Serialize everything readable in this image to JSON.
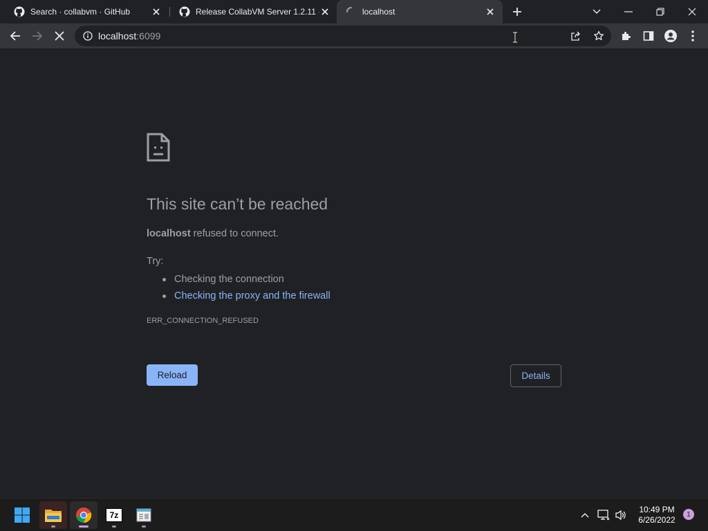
{
  "browser": {
    "tabs": [
      {
        "title": "Search · collabvm · GitHub",
        "icon": "github-icon",
        "active": false
      },
      {
        "title": "Release CollabVM Server 1.2.11 ·",
        "icon": "github-icon",
        "active": false
      },
      {
        "title": "localhost",
        "icon": "loading-spinner-icon",
        "active": true
      }
    ],
    "address": {
      "host": "localhost",
      "port": ":6099"
    }
  },
  "error_page": {
    "title": "This site can’t be reached",
    "summary_host": "localhost",
    "summary_rest": " refused to connect.",
    "try_label": "Try:",
    "suggestions": [
      {
        "text": "Checking the connection",
        "link": false
      },
      {
        "text": "Checking the proxy and the firewall",
        "link": true
      }
    ],
    "error_code": "ERR_CONNECTION_REFUSED",
    "reload_label": "Reload",
    "details_label": "Details"
  },
  "taskbar": {
    "apps": [
      "start-icon",
      "file-explorer-icon",
      "chrome-icon",
      "7zip-icon",
      "notepad-icon"
    ],
    "seven_zip_text": "7z",
    "time": "10:49 PM",
    "date": "6/26/2022",
    "notification_count": "1"
  },
  "colors": {
    "background": "#202124",
    "toolbar": "#35363a",
    "accent": "#8ab4f8",
    "muted_text": "#9aa0a6",
    "taskbar": "#1c1c1c"
  }
}
